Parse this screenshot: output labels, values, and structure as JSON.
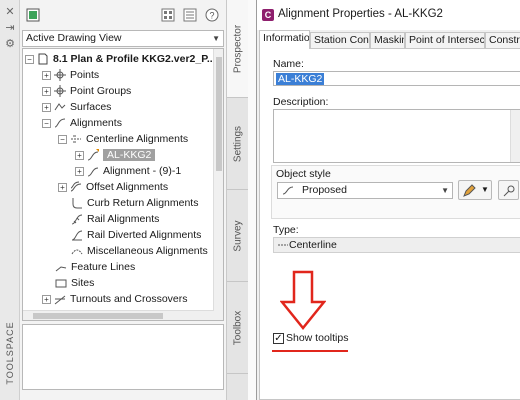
{
  "toolspace": {
    "label": "TOOLSPACE",
    "drawing_view": "Active Drawing View",
    "tabs": [
      "Prospector",
      "Settings",
      "Survey",
      "Toolbox"
    ],
    "tree": [
      {
        "label": "8.1 Plan & Profile KKG2.ver2_P...",
        "expander": "−"
      },
      {
        "label": "Points",
        "expander": "+"
      },
      {
        "label": "Point Groups",
        "expander": "+"
      },
      {
        "label": "Surfaces",
        "expander": "+"
      },
      {
        "label": "Alignments",
        "expander": "−"
      },
      {
        "label": "Centerline Alignments",
        "expander": "−"
      },
      {
        "label": "AL-KKG2",
        "expander": "+"
      },
      {
        "label": "Alignment - (9)-1",
        "expander": "+"
      },
      {
        "label": "Offset Alignments",
        "expander": "+"
      },
      {
        "label": "Curb Return Alignments",
        "expander": ""
      },
      {
        "label": "Rail Alignments",
        "expander": ""
      },
      {
        "label": "Rail Diverted Alignments",
        "expander": ""
      },
      {
        "label": "Miscellaneous Alignments",
        "expander": ""
      },
      {
        "label": "Feature Lines",
        "expander": ""
      },
      {
        "label": "Sites",
        "expander": ""
      },
      {
        "label": "Turnouts and Crossovers",
        "expander": "+"
      }
    ]
  },
  "dialog": {
    "title": "Alignment Properties - AL-KKG2",
    "title_icon": "C",
    "tabs": [
      "Information",
      "Station Control",
      "Masking",
      "Point of Intersection",
      "Constrain"
    ],
    "name_label": "Name:",
    "name_value": "AL-KKG2",
    "description_label": "Description:",
    "object_style_label": "Object style",
    "object_style_value": "Proposed",
    "type_label": "Type:",
    "type_value": "Centerline",
    "show_tooltips_label": "Show tooltips",
    "show_tooltips_checked": "✓"
  },
  "colors": {
    "annotation_red": "#e1261c",
    "selection_blue": "#3b7fd6",
    "title_icon_magenta": "#8e1f6d"
  }
}
